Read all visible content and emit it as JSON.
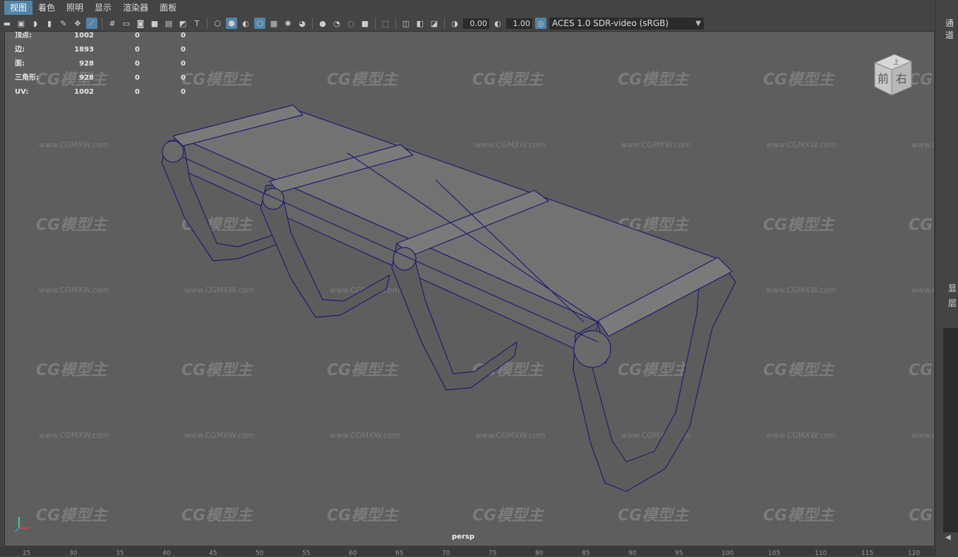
{
  "menu": [
    "视图",
    "着色",
    "照明",
    "显示",
    "渲染器",
    "面板"
  ],
  "toolbar": {
    "exposure": "0.00",
    "gamma": "1.00",
    "color_space": "ACES 1.0 SDR-video (sRGB)"
  },
  "hud": {
    "rows": [
      {
        "label": "顶点:",
        "v1": "1002",
        "v2": "0",
        "v3": "0"
      },
      {
        "label": "边:",
        "v1": "1893",
        "v2": "0",
        "v3": "0"
      },
      {
        "label": "面:",
        "v1": "928",
        "v2": "0",
        "v3": "0"
      },
      {
        "label": "三角形:",
        "v1": "928",
        "v2": "0",
        "v3": "0"
      },
      {
        "label": "UV:",
        "v1": "1002",
        "v2": "0",
        "v3": "0"
      }
    ]
  },
  "camera_label": "persp",
  "viewcube": {
    "top": "上",
    "front": "前",
    "right": "右"
  },
  "watermark": {
    "logo": "CG模型主",
    "url": "www.CGMXW.com"
  },
  "right_panel": {
    "title": "通道",
    "label1": "显",
    "label2": "层"
  },
  "timeline_ticks": [
    "25",
    "30",
    "35",
    "40",
    "45",
    "50",
    "55",
    "60",
    "65",
    "70",
    "75",
    "80",
    "85",
    "90",
    "95",
    "100",
    "105",
    "110",
    "115",
    "120"
  ]
}
